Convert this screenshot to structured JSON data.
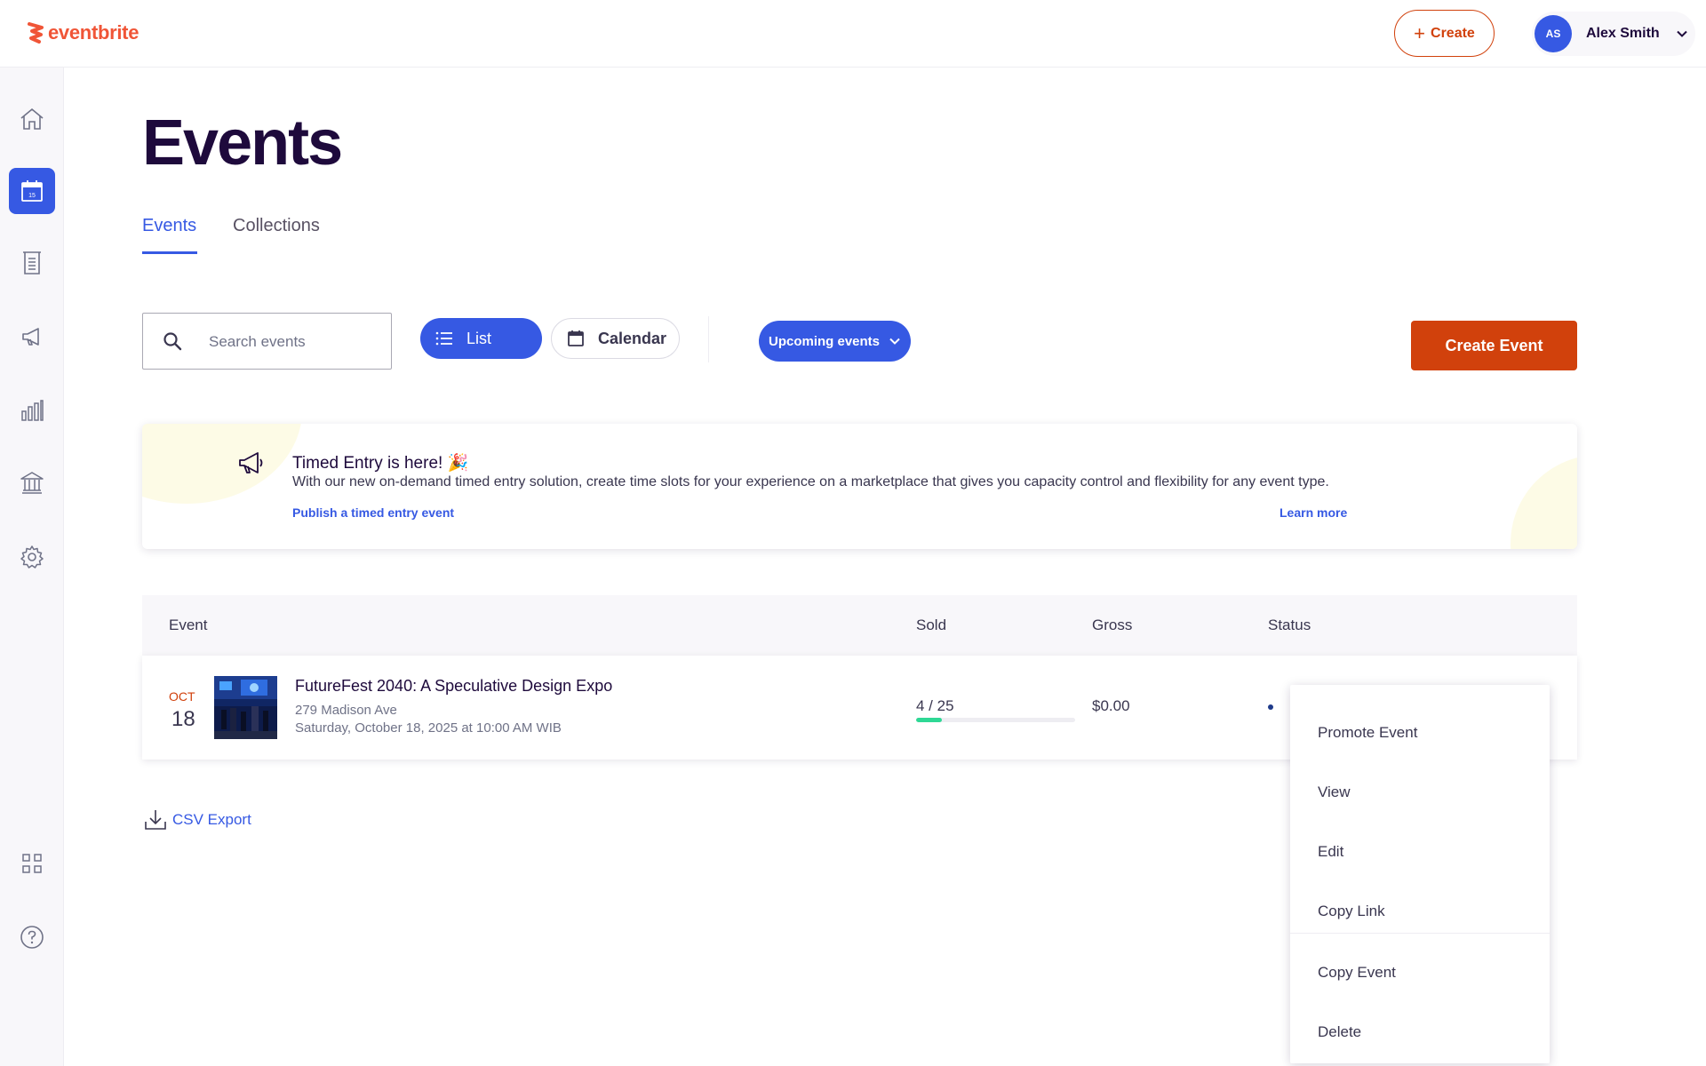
{
  "app": {
    "logo_text": "eventbrite"
  },
  "topbar": {
    "create_label": "Create",
    "account": {
      "initials": "AS",
      "name": "Alex Smith"
    }
  },
  "sidebar": {
    "items": [
      {
        "id": "home",
        "icon": "home-icon",
        "active": false
      },
      {
        "id": "events",
        "icon": "calendar-icon",
        "active": true,
        "badge": "15"
      },
      {
        "id": "orders",
        "icon": "receipt-icon",
        "active": false
      },
      {
        "id": "marketing",
        "icon": "megaphone-icon",
        "active": false
      },
      {
        "id": "reports",
        "icon": "bar-chart-icon",
        "active": false
      },
      {
        "id": "finance",
        "icon": "bank-icon",
        "active": false
      },
      {
        "id": "settings",
        "icon": "gear-icon",
        "active": false
      },
      {
        "id": "apps",
        "icon": "grid-icon",
        "active": false
      },
      {
        "id": "help",
        "icon": "help-icon",
        "active": false
      }
    ]
  },
  "page": {
    "title": "Events",
    "tabs": [
      {
        "label": "Events",
        "active": true
      },
      {
        "label": "Collections",
        "active": false
      }
    ]
  },
  "toolbar": {
    "search_placeholder": "Search events",
    "search_value": "",
    "list_label": "List",
    "calendar_label": "Calendar",
    "filter_label": "Upcoming events",
    "create_event_label": "Create Event"
  },
  "banner": {
    "title": "Timed Entry is here! 🎉",
    "description": "With our new on-demand timed entry solution, create time slots for your experience on a marketplace that gives you capacity control and flexibility for any event type.",
    "publish_link": "Publish a timed entry event",
    "learn_link": "Learn more"
  },
  "table": {
    "headers": {
      "event": "Event",
      "sold": "Sold",
      "gross": "Gross",
      "status": "Status"
    },
    "rows": [
      {
        "month": "OCT",
        "day": "18",
        "name": "FutureFest 2040: A Speculative Design Expo",
        "address": "279 Madison Ave",
        "when": "Saturday, October 18, 2025 at 10:00 AM WIB",
        "sold_text": "4 / 25",
        "sold_fraction": 0.16,
        "gross": "$0.00"
      }
    ]
  },
  "csv_label": "CSV Export",
  "menu": {
    "items": [
      "Promote Event",
      "View",
      "Edit",
      "Copy Link",
      "Copy Event",
      "Delete"
    ]
  },
  "colors": {
    "brand": "#f05537",
    "primary_blue": "#3659e3",
    "cta_orange": "#d1410c",
    "progress_green": "#2ed895"
  }
}
